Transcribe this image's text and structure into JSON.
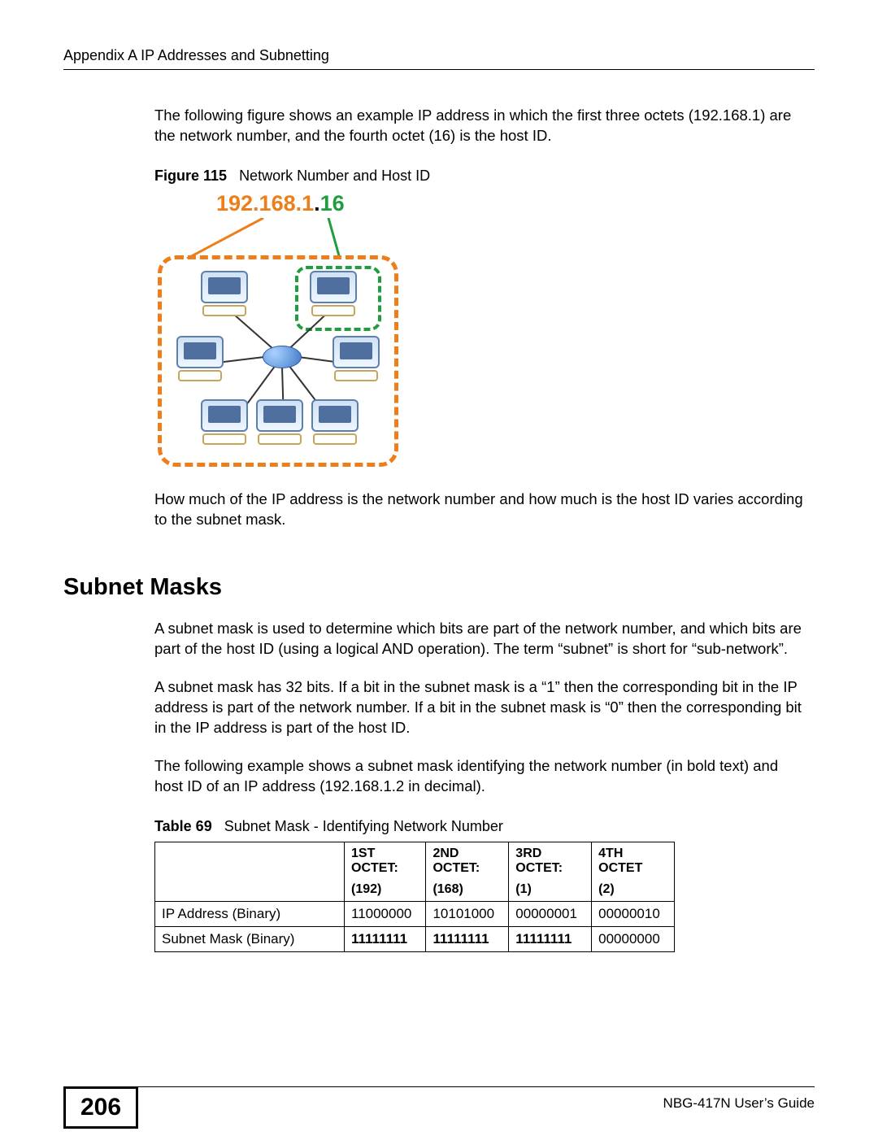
{
  "header": {
    "running_head": "Appendix A IP Addresses and Subnetting"
  },
  "intro_para": "The following figure shows an example IP address in which the first three octets (192.168.1) are the network number, and the fourth octet (16) is the host ID.",
  "figure": {
    "label": "Figure 115",
    "caption": "Network Number and Host ID",
    "ip_network": "192.168.1",
    "ip_dot": ".",
    "ip_host": "16"
  },
  "after_fig_para": "How much of the IP address is the network number and how much is the host ID varies according to the subnet mask.",
  "section_heading": "Subnet Masks",
  "para_a": "A subnet mask is used to determine which bits are part of the network number, and which bits are part of the host ID (using a logical AND operation). The term “subnet” is short for “sub-network”.",
  "para_b": "A subnet mask has 32 bits. If a bit in the subnet mask is a “1” then the corresponding bit in the IP address is part of the network number. If a bit in the subnet mask is “0” then the corresponding bit in the IP address is part of the host ID.",
  "para_c": "The following example shows a subnet mask identifying the network number (in bold text) and host ID of an IP address (192.168.1.2 in decimal).",
  "table": {
    "label": "Table 69",
    "caption": "Subnet Mask - Identifying Network Number",
    "columns": [
      {
        "line1": "1ST",
        "line2": "OCTET:",
        "sub": "(192)"
      },
      {
        "line1": "2ND",
        "line2": "OCTET:",
        "sub": "(168)"
      },
      {
        "line1": "3RD",
        "line2": "OCTET:",
        "sub": "(1)"
      },
      {
        "line1": "4TH",
        "line2": "OCTET",
        "sub": "(2)"
      }
    ],
    "rows": [
      {
        "label": "IP Address (Binary)",
        "cells": [
          {
            "text": "11000000",
            "bold": false
          },
          {
            "text": "10101000",
            "bold": false
          },
          {
            "text": "00000001",
            "bold": false
          },
          {
            "text": "00000010",
            "bold": false
          }
        ]
      },
      {
        "label": "Subnet Mask (Binary)",
        "cells": [
          {
            "text": "11111111",
            "bold": true
          },
          {
            "text": "11111111",
            "bold": true
          },
          {
            "text": "11111111",
            "bold": true
          },
          {
            "text": "00000000",
            "bold": false
          }
        ]
      }
    ]
  },
  "footer": {
    "page_number": "206",
    "guide": "NBG-417N User’s Guide"
  }
}
